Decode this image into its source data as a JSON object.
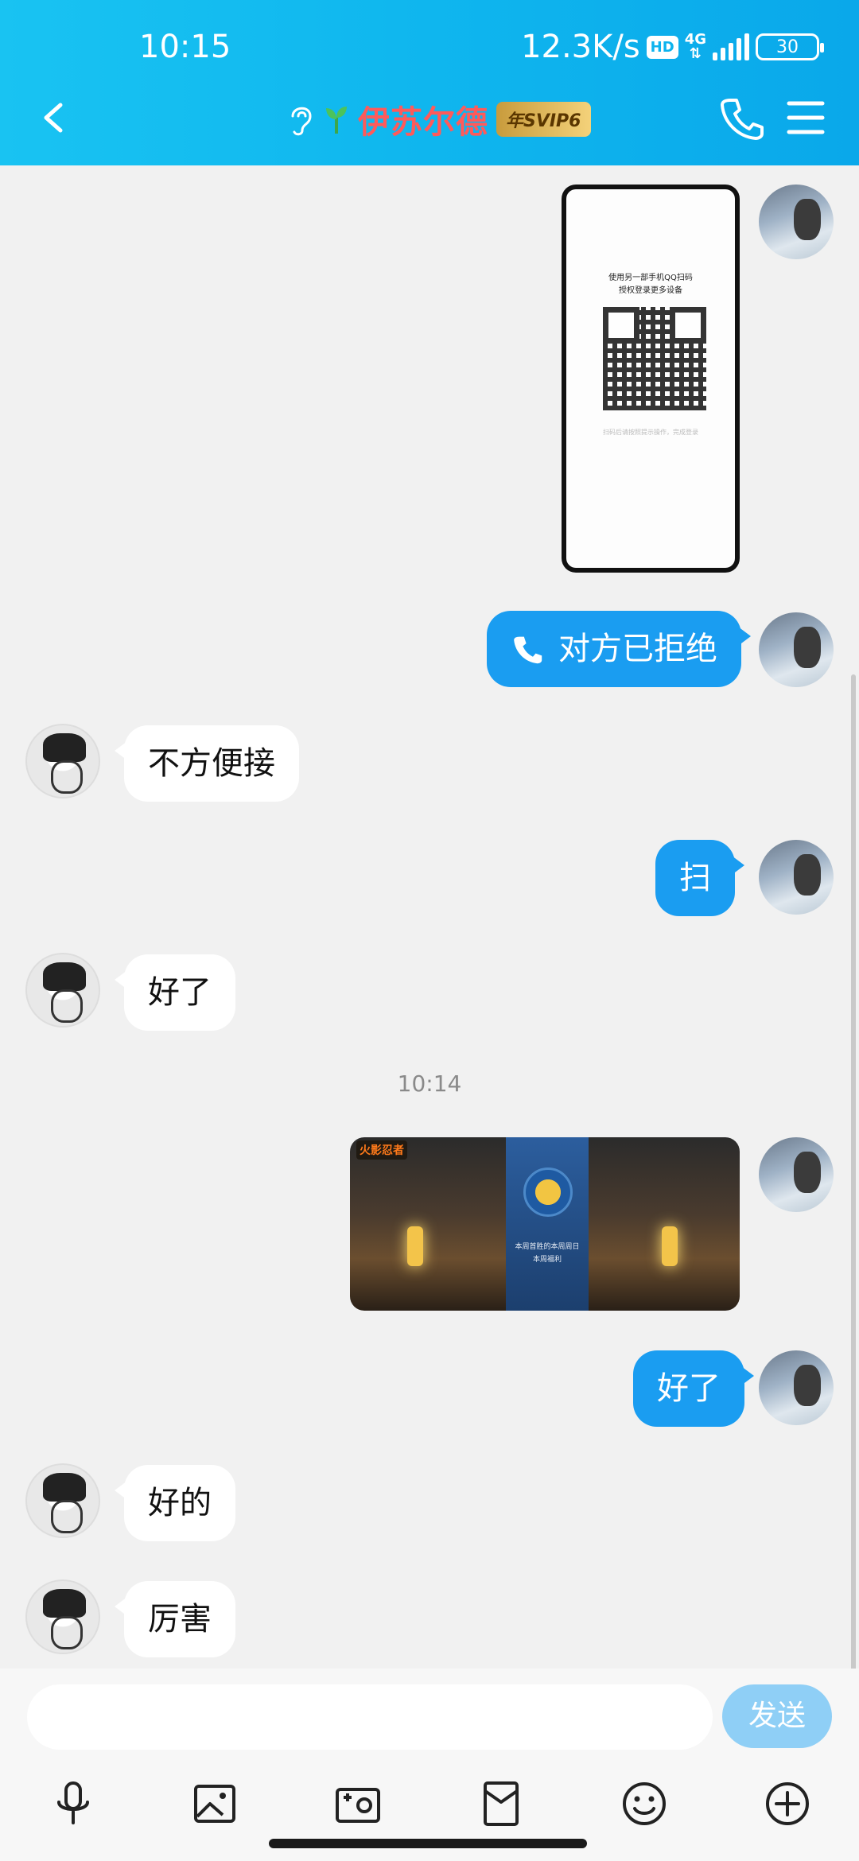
{
  "status_bar": {
    "time": "10:15",
    "net_speed": "12.3K/s",
    "hd": "HD",
    "network_type": "4G",
    "battery": "30"
  },
  "header": {
    "title": "伊苏尔德",
    "badge": "年SVIP6",
    "icons": [
      "back-icon",
      "ear-icon",
      "sprout-icon",
      "phone-icon",
      "menu-icon"
    ]
  },
  "messages": {
    "image_qr": {
      "qr_line1": "使用另一部手机QQ扫码",
      "qr_line2": "授权登录更多设备",
      "qr_foot": "扫码后请按照提示操作，完成登录"
    },
    "call": "对方已拒绝",
    "m1": "不方便接",
    "m2": "扫",
    "m3": "好了",
    "time_divider": "10:14",
    "image_game": {
      "logo": "火影忍者",
      "panel_line1": "本周首胜的本周周日",
      "panel_line2": "本周福利"
    },
    "m4": "好了",
    "m5": "好的",
    "m6": "厉害"
  },
  "input": {
    "placeholder": "",
    "send_label": "发送"
  },
  "toolbar": [
    "microphone-icon",
    "image-icon",
    "camera-icon",
    "red-packet-icon",
    "emoji-icon",
    "plus-icon"
  ],
  "colors": {
    "header_gradient_start": "#19c3f2",
    "header_gradient_end": "#0aa8ea",
    "outgoing_bubble": "#1a9df1",
    "incoming_bubble": "#ffffff",
    "send_button": "#8fcff6",
    "background": "#f1f1f1"
  }
}
